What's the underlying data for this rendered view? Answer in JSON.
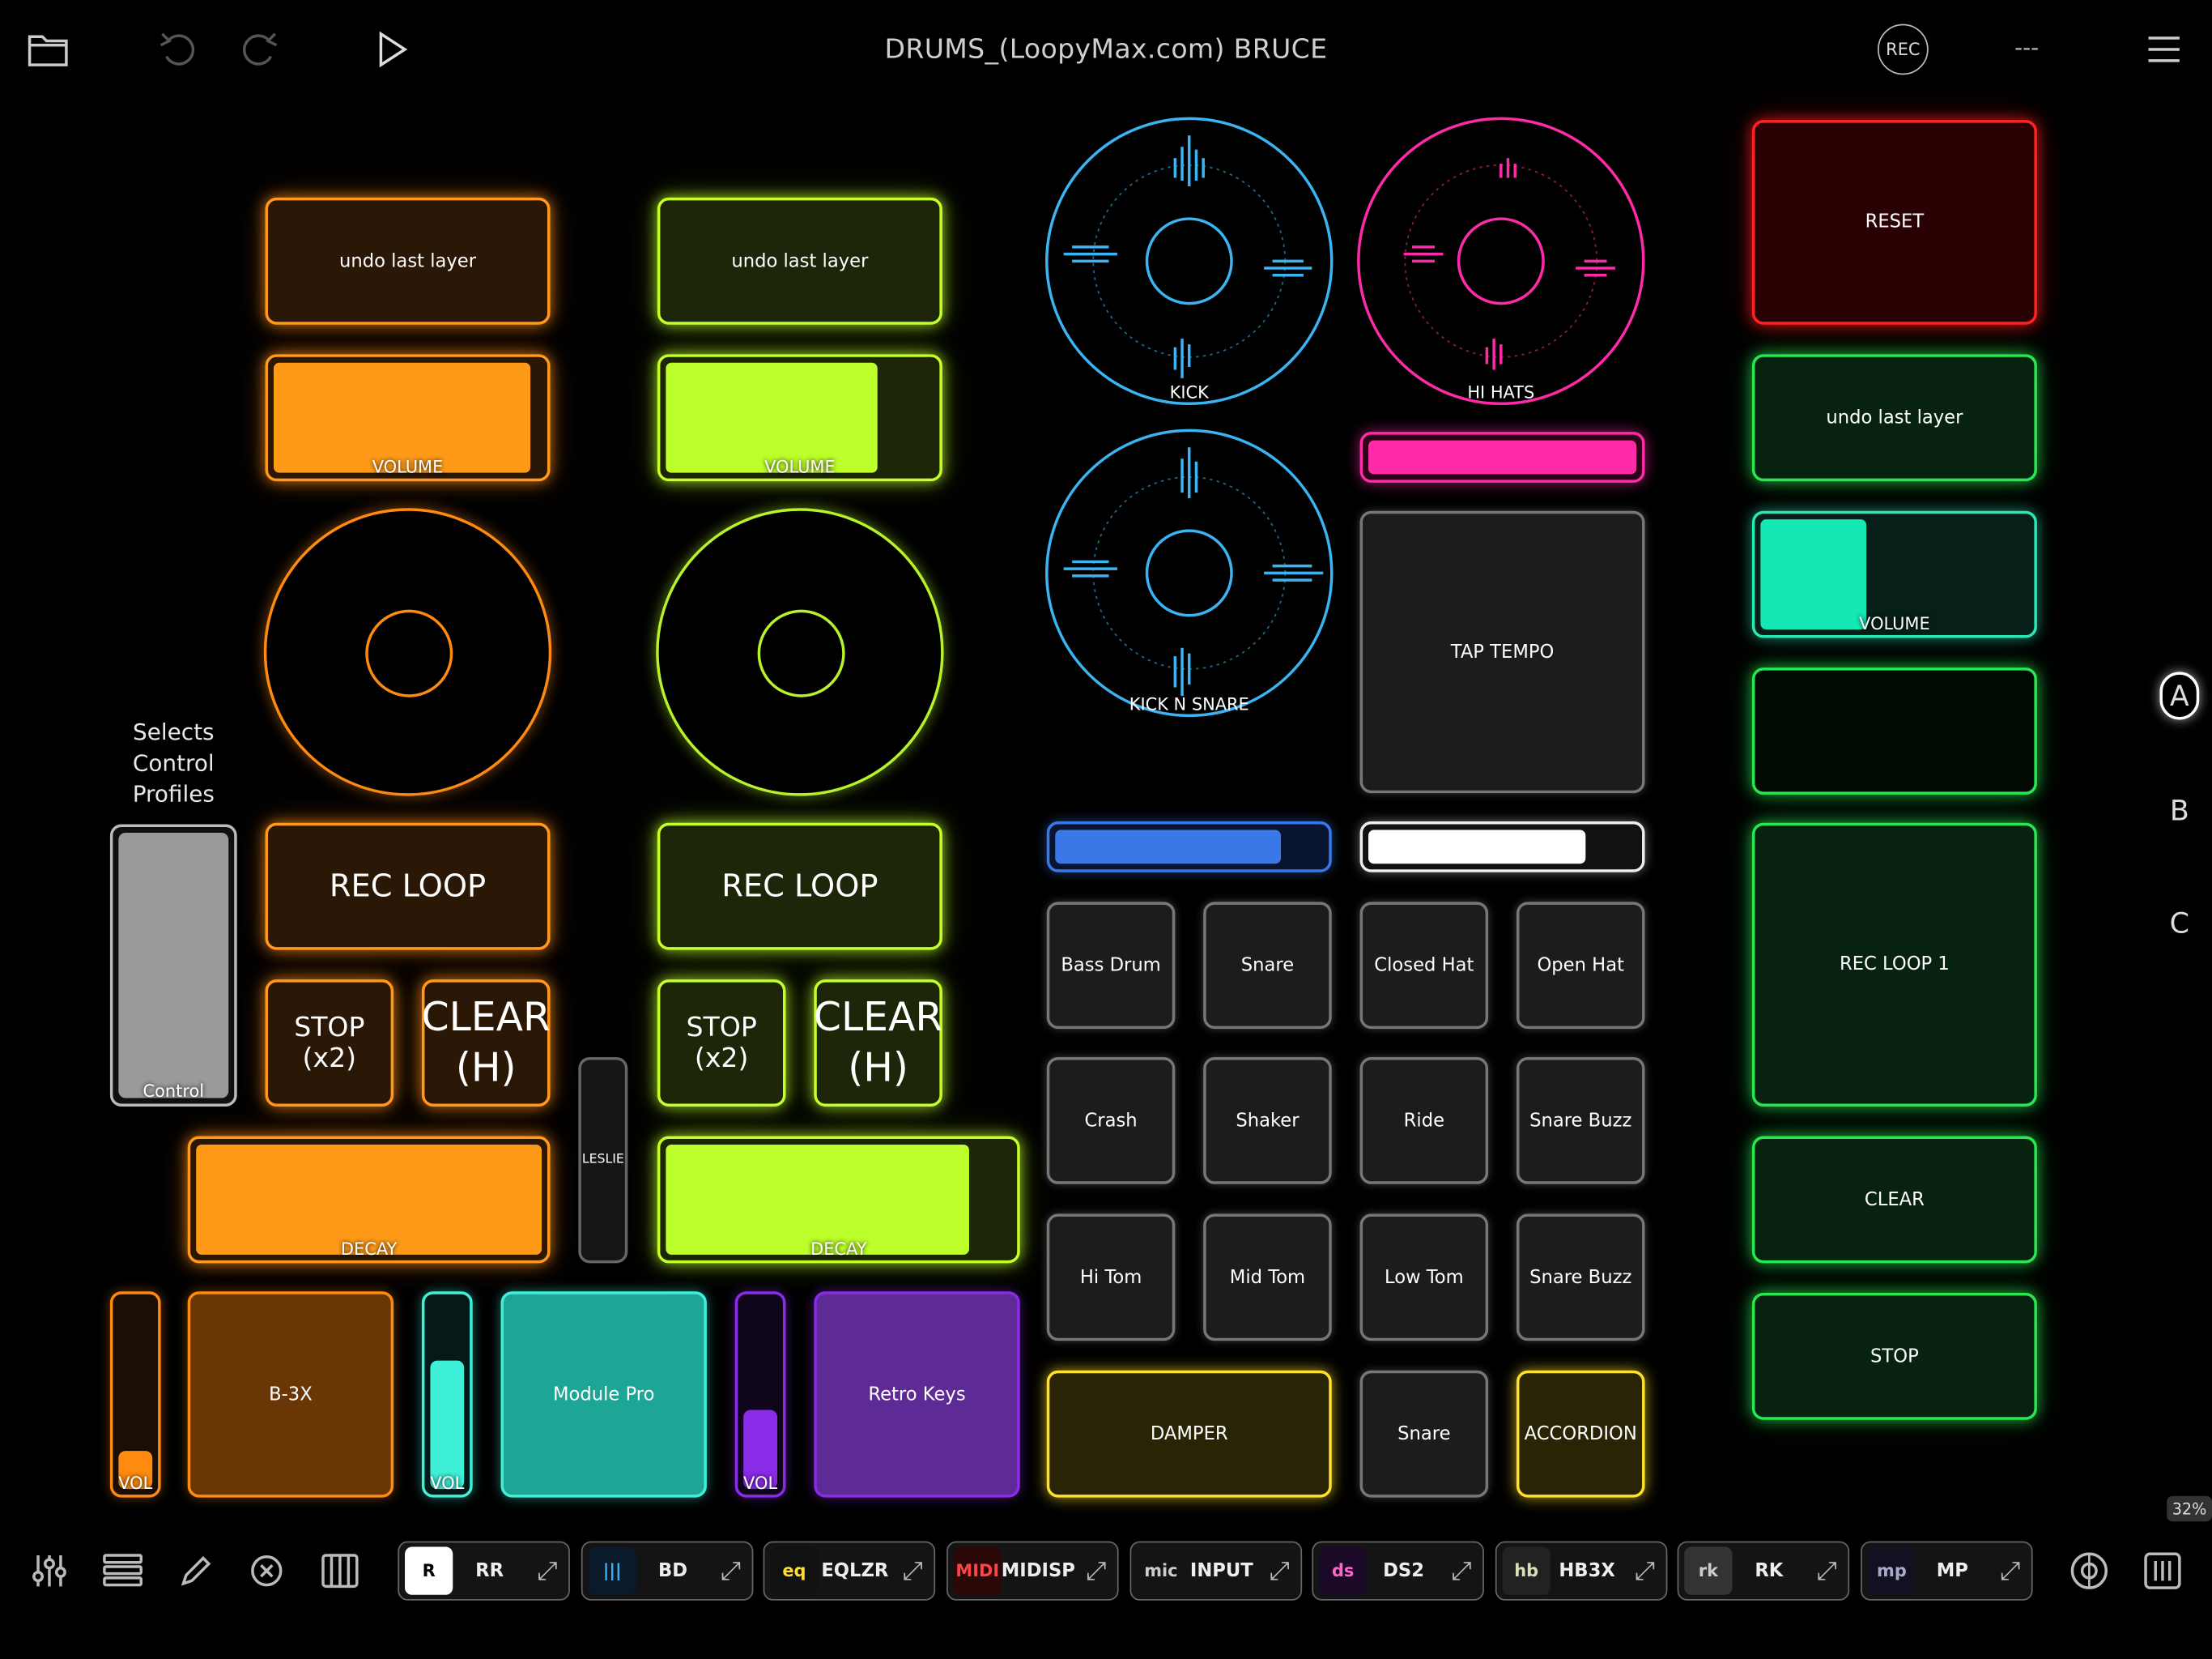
{
  "header": {
    "title": "DRUMS_(LoopyMax.com) BRUCE",
    "rec_label": "REC",
    "status": "---",
    "icons": [
      "folder-icon",
      "undo-icon",
      "redo-icon",
      "play-icon",
      "menu-icon"
    ]
  },
  "track1": {
    "undo": "undo last layer",
    "volume_label": "VOLUME",
    "volume_level": 0.96,
    "rec": "REC LOOP",
    "stop": "STOP (x2)",
    "clear": "CLEAR (H)",
    "decay_label": "DECAY",
    "decay_level": 1.0,
    "color": "#ff9a1e"
  },
  "track2": {
    "undo": "undo last layer",
    "volume_label": "VOLUME",
    "volume_level": 0.8,
    "rec": "REC LOOP",
    "stop": "STOP (x2)",
    "clear": "CLEAR (H)",
    "decay_label": "DECAY",
    "decay_level": 0.88,
    "color": "#c4ff2a"
  },
  "control": {
    "caption": "Selects Control Profiles",
    "label": "Control"
  },
  "leslie": "LESLIE",
  "instruments": [
    {
      "label": "B-3X",
      "vol": "VOL",
      "vol_level": 0.25,
      "color": "#ff8a10"
    },
    {
      "label": "Module Pro",
      "vol": "VOL",
      "vol_level": 0.7,
      "color": "#3ff0d8"
    },
    {
      "label": "Retro Keys",
      "vol": "VOL",
      "vol_level": 0.45,
      "color": "#8a2be8"
    }
  ],
  "loops": {
    "kick": "KICK",
    "hihats": "HI HATS",
    "kicksnare": "KICK N SNARE",
    "hihat_level": 1.0,
    "kick_level": 0.85,
    "white_level": 0.82
  },
  "tap_tempo": "TAP TEMPO",
  "drum_pads": [
    [
      "Bass Drum",
      "Snare",
      "Closed Hat",
      "Open Hat"
    ],
    [
      "Crash",
      "Shaker",
      "Ride",
      "Snare Buzz"
    ],
    [
      "Hi Tom",
      "Mid Tom",
      "Low Tom",
      "Snare Buzz"
    ]
  ],
  "bottom_pads": {
    "damper": "DAMPER",
    "snare": "Snare",
    "accordion": "ACCORDION"
  },
  "right": {
    "reset": "RESET",
    "undo": "undo last layer",
    "volume_label": "VOLUME",
    "volume_level": 0.42,
    "rec": "REC LOOP 1",
    "clear": "CLEAR",
    "stop": "STOP"
  },
  "profiles": [
    "A",
    "B",
    "C"
  ],
  "zoom": "32%",
  "plugins": [
    {
      "name": "RR",
      "icon": "R"
    },
    {
      "name": "BD",
      "icon": "|||"
    },
    {
      "name": "EQLZR",
      "icon": "eq"
    },
    {
      "name": "MIDISP",
      "icon": "MIDI"
    },
    {
      "name": "INPUT",
      "icon": "mic"
    },
    {
      "name": "DS2",
      "icon": "ds"
    },
    {
      "name": "HB3X",
      "icon": "hb"
    },
    {
      "name": "RK",
      "icon": "rk"
    },
    {
      "name": "MP",
      "icon": "mp"
    }
  ]
}
